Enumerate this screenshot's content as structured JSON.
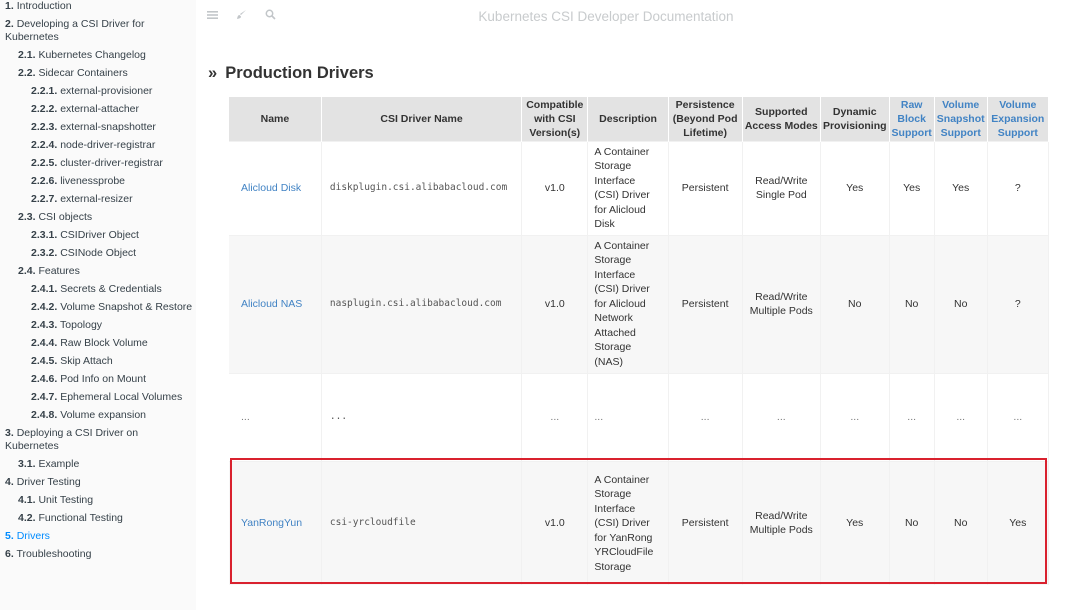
{
  "header": {
    "book_title": "Kubernetes CSI Developer Documentation",
    "icons": [
      "menu-icon",
      "brush-icon",
      "search-icon"
    ]
  },
  "sidebar": {
    "items": [
      {
        "num": "1.",
        "label": "Introduction",
        "level": 1
      },
      {
        "num": "2.",
        "label": "Developing a CSI Driver for Kubernetes",
        "level": 1
      },
      {
        "num": "2.1.",
        "label": "Kubernetes Changelog",
        "level": 2
      },
      {
        "num": "2.2.",
        "label": "Sidecar Containers",
        "level": 2
      },
      {
        "num": "2.2.1.",
        "label": "external-provisioner",
        "level": 3
      },
      {
        "num": "2.2.2.",
        "label": "external-attacher",
        "level": 3
      },
      {
        "num": "2.2.3.",
        "label": "external-snapshotter",
        "level": 3
      },
      {
        "num": "2.2.4.",
        "label": "node-driver-registrar",
        "level": 3
      },
      {
        "num": "2.2.5.",
        "label": "cluster-driver-registrar",
        "level": 3
      },
      {
        "num": "2.2.6.",
        "label": "livenessprobe",
        "level": 3
      },
      {
        "num": "2.2.7.",
        "label": "external-resizer",
        "level": 3
      },
      {
        "num": "2.3.",
        "label": "CSI objects",
        "level": 2
      },
      {
        "num": "2.3.1.",
        "label": "CSIDriver Object",
        "level": 3
      },
      {
        "num": "2.3.2.",
        "label": "CSINode Object",
        "level": 3
      },
      {
        "num": "2.4.",
        "label": "Features",
        "level": 2
      },
      {
        "num": "2.4.1.",
        "label": "Secrets & Credentials",
        "level": 3
      },
      {
        "num": "2.4.2.",
        "label": "Volume Snapshot & Restore",
        "level": 3
      },
      {
        "num": "2.4.3.",
        "label": "Topology",
        "level": 3
      },
      {
        "num": "2.4.4.",
        "label": "Raw Block Volume",
        "level": 3
      },
      {
        "num": "2.4.5.",
        "label": "Skip Attach",
        "level": 3
      },
      {
        "num": "2.4.6.",
        "label": "Pod Info on Mount",
        "level": 3
      },
      {
        "num": "2.4.7.",
        "label": "Ephemeral Local Volumes",
        "level": 3
      },
      {
        "num": "2.4.8.",
        "label": "Volume expansion",
        "level": 3
      },
      {
        "num": "3.",
        "label": "Deploying a CSI Driver on Kubernetes",
        "level": 1
      },
      {
        "num": "3.1.",
        "label": "Example",
        "level": 2
      },
      {
        "num": "4.",
        "label": "Driver Testing",
        "level": 1
      },
      {
        "num": "4.1.",
        "label": "Unit Testing",
        "level": 2
      },
      {
        "num": "4.2.",
        "label": "Functional Testing",
        "level": 2
      },
      {
        "num": "5.",
        "label": "Drivers",
        "level": 1,
        "active": true
      },
      {
        "num": "6.",
        "label": "Troubleshooting",
        "level": 1
      }
    ]
  },
  "main": {
    "heading_marker": "»",
    "heading": "Production Drivers",
    "table": {
      "columns": [
        {
          "label": "Name",
          "link": false
        },
        {
          "label": "CSI Driver Name",
          "link": false
        },
        {
          "label": "Compatible with CSI Version(s)",
          "link": false
        },
        {
          "label": "Description",
          "link": false
        },
        {
          "label": "Persistence (Beyond Pod Lifetime)",
          "link": false
        },
        {
          "label": "Supported Access Modes",
          "link": false
        },
        {
          "label": "Dynamic Provisioning",
          "link": false
        },
        {
          "label": "Raw Block Support",
          "link": true
        },
        {
          "label": "Volume Snapshot Support",
          "link": true
        },
        {
          "label": "Volume Expansion Support",
          "link": true
        }
      ],
      "rows": [
        {
          "name": "Alicloud Disk",
          "driver": "diskplugin.csi.alibabacloud.com",
          "version": "v1.0",
          "description": "A Container Storage Interface (CSI) Driver for Alicloud Disk",
          "persistence": "Persistent",
          "access_modes": "Read/Write Single Pod",
          "dynamic": "Yes",
          "raw_block": "Yes",
          "snapshot": "Yes",
          "expansion": "?"
        },
        {
          "name": "Alicloud NAS",
          "driver": "nasplugin.csi.alibabacloud.com",
          "version": "v1.0",
          "description": "A Container Storage Interface (CSI) Driver for Alicloud Network Attached Storage (NAS)",
          "persistence": "Persistent",
          "access_modes": "Read/Write Multiple Pods",
          "dynamic": "No",
          "raw_block": "No",
          "snapshot": "No",
          "expansion": "?"
        },
        {
          "name": "...",
          "driver": "...",
          "version": "...",
          "description": "...",
          "persistence": "...",
          "access_modes": "...",
          "dynamic": "...",
          "raw_block": "...",
          "snapshot": "...",
          "expansion": "..."
        },
        {
          "name": "YanRongYun",
          "driver": "csi-yrcloudfile",
          "version": "v1.0",
          "description": "A Container Storage Interface (CSI) Driver for YanRong YRCloudFile Storage",
          "persistence": "Persistent",
          "access_modes": "Read/Write Multiple Pods",
          "dynamic": "Yes",
          "raw_block": "No",
          "snapshot": "No",
          "expansion": "Yes",
          "highlighted": true
        }
      ]
    }
  },
  "colors": {
    "link": "#4183c4",
    "active_nav": "#008cff",
    "highlight_border": "#d9212e",
    "table_header_bg": "#e3e3e3"
  }
}
